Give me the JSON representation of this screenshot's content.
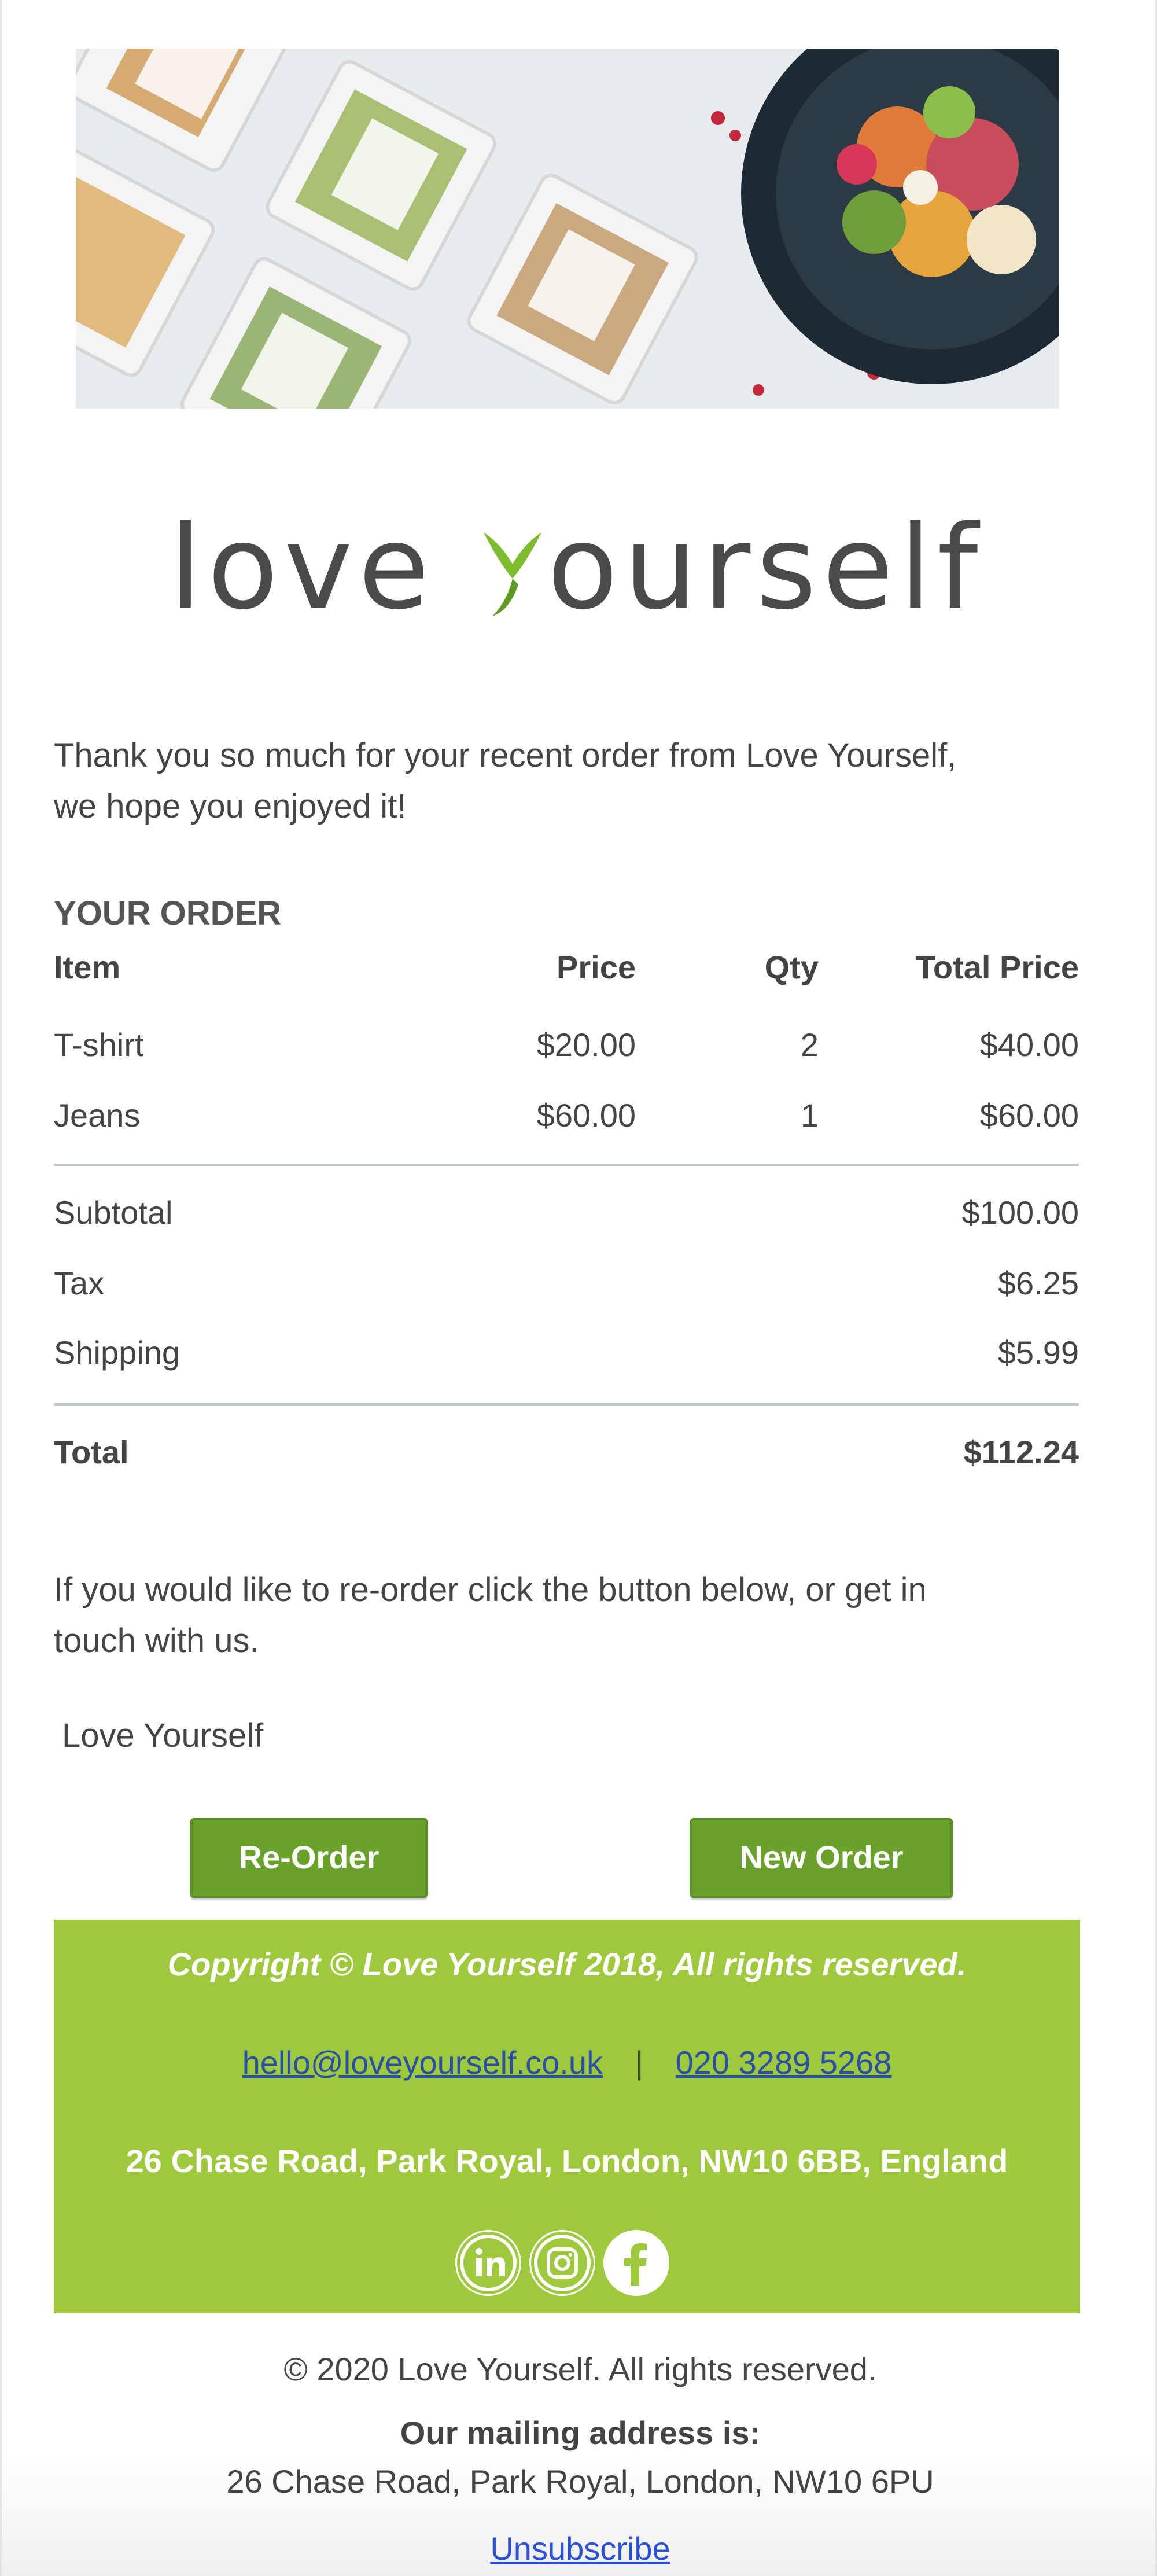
{
  "brand": {
    "logo_text_before": "love ",
    "logo_text_after": "ourself",
    "accent_green": "#6aa12a",
    "footer_green": "#9ec93d"
  },
  "hero": {
    "image": "meal-boxes-and-salad-bowl-photo"
  },
  "intro": {
    "line1": "Thank you so much for your recent order from Love Yourself,",
    "line2": "we hope you enjoyed it!"
  },
  "order": {
    "title": "YOUR ORDER",
    "headers": {
      "item": "Item",
      "price": "Price",
      "qty": "Qty",
      "total": "Total Price"
    },
    "items": [
      {
        "item": "T-shirt",
        "price": "$20.00",
        "qty": "2",
        "total": "$40.00"
      },
      {
        "item": "Jeans",
        "price": "$60.00",
        "qty": "1",
        "total": "$60.00"
      }
    ],
    "summary": {
      "subtotal_label": "Subtotal",
      "subtotal_value": "$100.00",
      "tax_label": "Tax",
      "tax_value": "$6.25",
      "shipping_label": "Shipping",
      "shipping_value": "$5.99",
      "total_label": "Total",
      "total_value": "$112.24"
    }
  },
  "reorder_note": {
    "line1": "If you would like to re-order click the button below, or get in",
    "line2": "touch with us."
  },
  "signature": "Love Yourself",
  "buttons": {
    "reorder": "Re-Order",
    "new_order": "New Order"
  },
  "footer": {
    "copyright": "Copyright © Love Yourself 2018, All rights reserved.",
    "email": "hello@loveyourself.co.uk",
    "separator": "|",
    "phone": "020 3289 5268",
    "address": "26 Chase Road, Park Royal, London, NW10 6BB, England",
    "social": [
      "linkedin-icon",
      "instagram-icon",
      "facebook-icon"
    ]
  },
  "bottom": {
    "copyright": "© 2020 Love Yourself. All rights reserved.",
    "mailing_title": "Our mailing address is:",
    "mailing_address": "26 Chase Road, Park Royal, London, NW10 6PU",
    "unsubscribe": "Unsubscribe"
  }
}
